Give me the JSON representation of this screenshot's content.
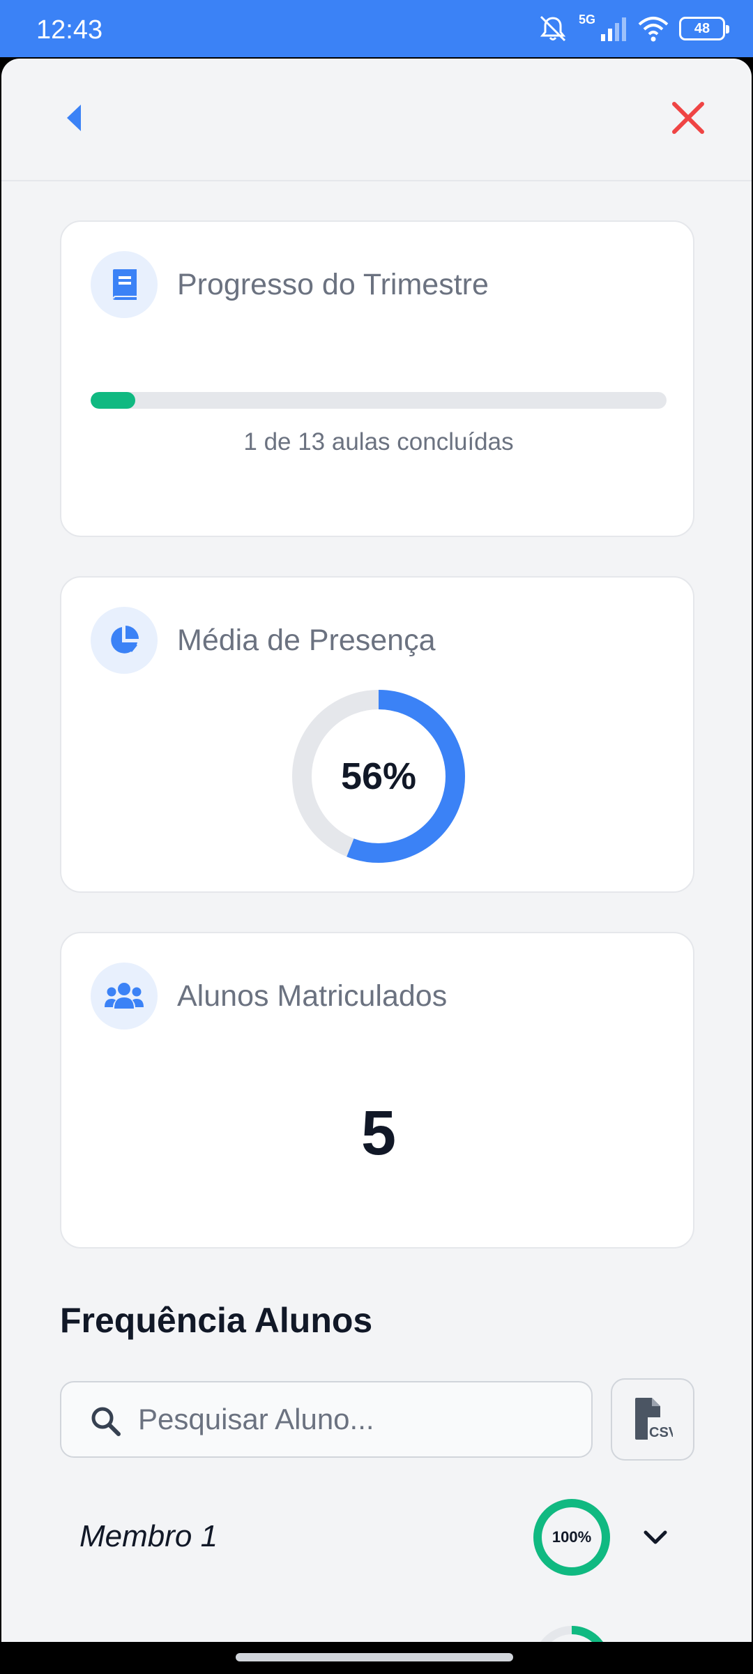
{
  "status_bar": {
    "time": "12:43",
    "network": "5G",
    "battery": "48"
  },
  "cards": {
    "progress": {
      "title": "Progresso do Trimestre",
      "completed": 1,
      "total": 13,
      "caption": "1 de 13 aulas concluídas",
      "bar_color": "#10b981",
      "icon": "book-icon"
    },
    "attendance": {
      "title": "Média de Presença",
      "percent": 56,
      "label": "56%",
      "ring_color": "#3b82f6",
      "icon": "pie-chart-icon"
    },
    "enrolled": {
      "title": "Alunos Matriculados",
      "count": "5",
      "icon": "users-icon"
    }
  },
  "attendance_section": {
    "title": "Frequência Alunos",
    "search_placeholder": "Pesquisar Aluno...",
    "export_button": "csv-file-icon",
    "members": [
      {
        "name": "Membro 1",
        "percent": 100,
        "percent_label": "100%",
        "ring_color": "#10b981"
      }
    ]
  },
  "colors": {
    "accent": "#3b82f6",
    "close": "#ef4444",
    "success": "#10b981"
  }
}
